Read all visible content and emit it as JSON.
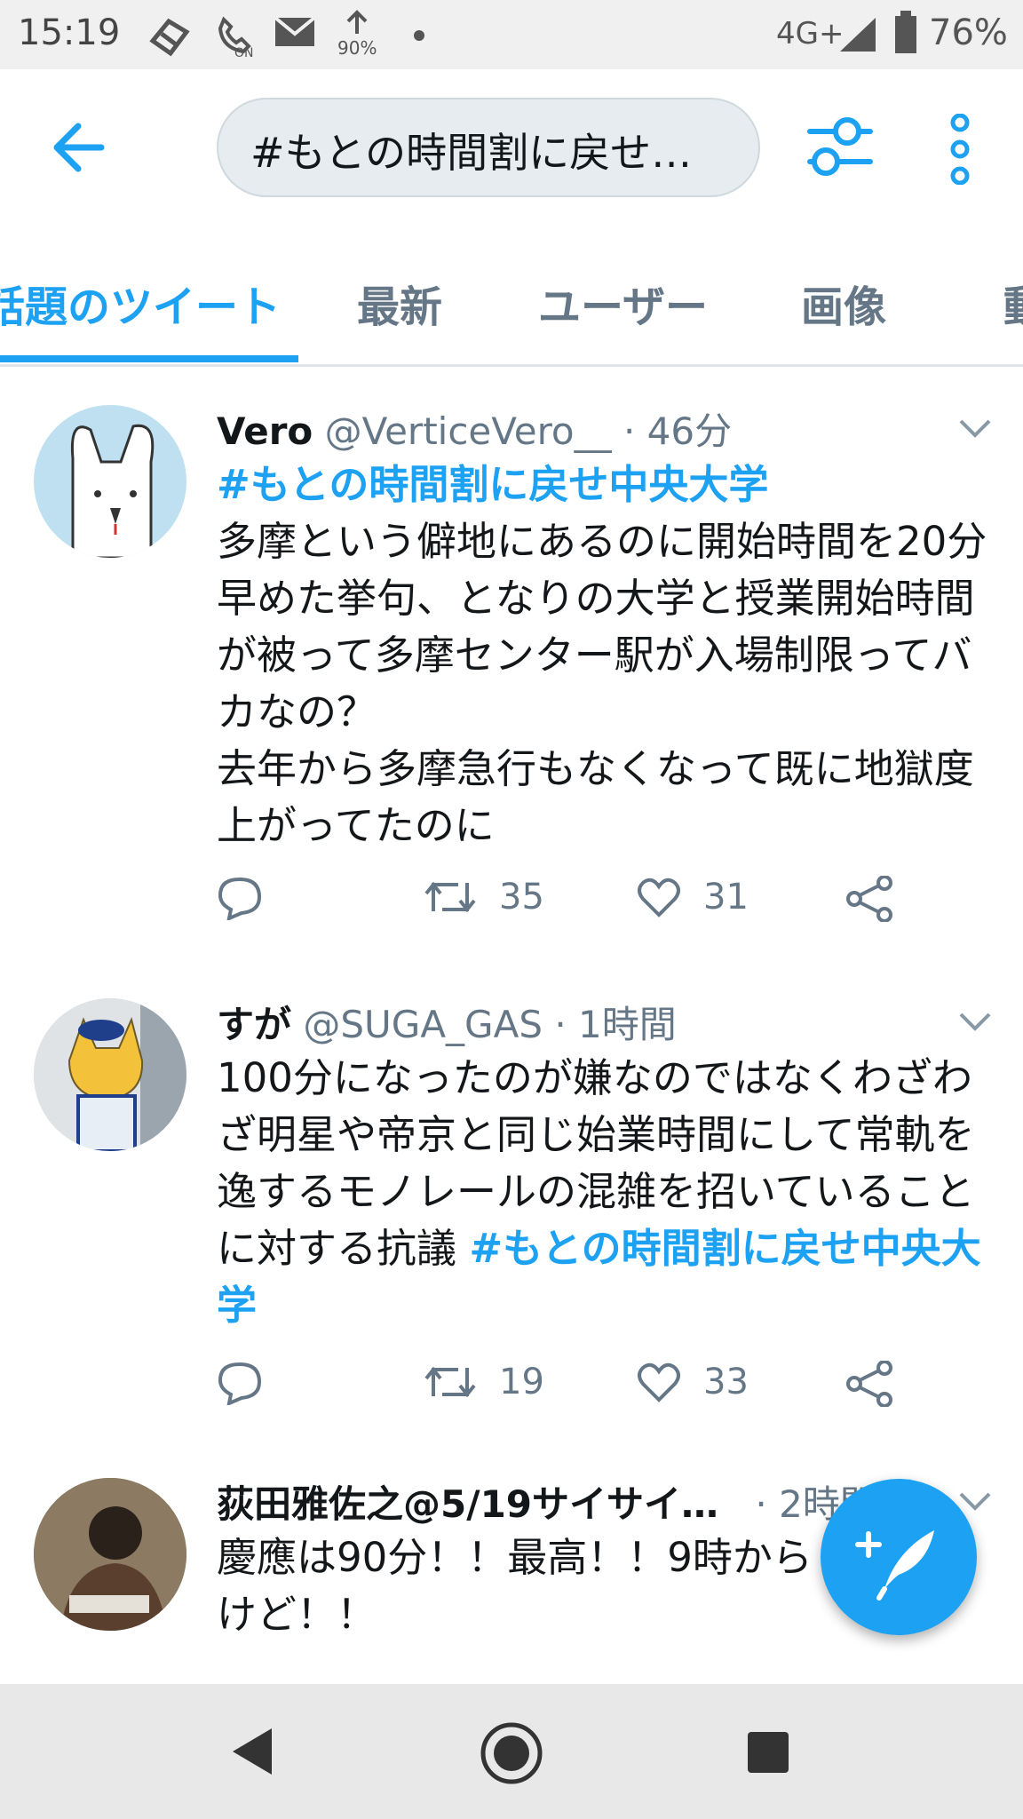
{
  "status_bar": {
    "time": "15:19",
    "data_speed": "90%",
    "network": "4G+",
    "battery": "76%"
  },
  "header": {
    "search_query": "#もとの時間割に戻せ…"
  },
  "tabs": [
    {
      "label": "話題のツイート",
      "active": true
    },
    {
      "label": "最新"
    },
    {
      "label": "ユーザー"
    },
    {
      "label": "画像"
    },
    {
      "label": "動"
    }
  ],
  "tweets": [
    {
      "name": "Vero",
      "handle": "@VerticeVero__",
      "time": "· 46分",
      "hashtag": "#もとの時間割に戻せ中央大学",
      "text": "多摩という僻地にあるのに開始時間を20分早めた挙句、となりの大学と授業開始時間が被って多摩センター駅が入場制限ってバカなの？\n去年から多摩急行もなくなって既に地獄度上がってたのに",
      "retweets": "35",
      "likes": "31"
    },
    {
      "name": "すが",
      "handle": "@SUGA_GAS",
      "time": "· 1時間",
      "text": "100分になったのが嫌なのではなくわざわざ明星や帝京と同じ始業時間にして常軌を逸するモノレールの混雑を招いていることに対する抗議 ",
      "hashtag": "#もとの時間割に戻せ中央大学",
      "retweets": "19",
      "likes": "33"
    },
    {
      "name": "荻田雅佐之@5/19サイサイ…",
      "time": "· 2時間",
      "text": "慶應は90分！！最高！！9時から\nけど！！"
    }
  ],
  "colors": {
    "accent": "#1da1f2",
    "secondary_text": "#657786"
  }
}
